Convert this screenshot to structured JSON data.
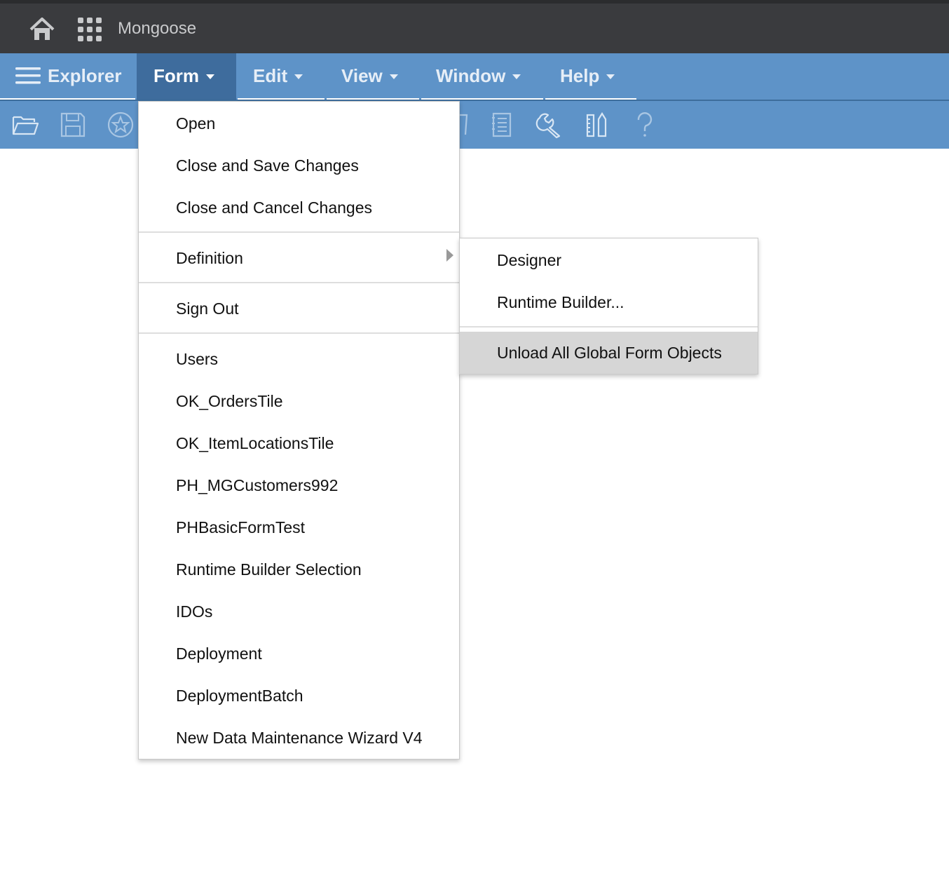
{
  "app": {
    "name": "Mongoose",
    "icons": {
      "home": "home-icon",
      "apps": "apps-grid-icon"
    }
  },
  "menubar": {
    "explorer": "Explorer",
    "form": "Form",
    "edit": "Edit",
    "view": "View",
    "window": "Window",
    "help": "Help"
  },
  "toolbar": {
    "icons": [
      "open-folder-icon",
      "save-icon",
      "favorite-star-icon",
      "clipboard-icon",
      "form-document-icon",
      "wrench-icon",
      "design-tools-icon",
      "help-icon"
    ]
  },
  "form_menu": {
    "open": "Open",
    "close_save": "Close and Save Changes",
    "close_cancel": "Close and Cancel Changes",
    "definition": "Definition",
    "sign_out": "Sign Out",
    "forms": [
      "Users",
      "OK_OrdersTile",
      "OK_ItemLocationsTile",
      "PH_MGCustomers992",
      "PHBasicFormTest",
      "Runtime Builder Selection",
      "IDOs",
      "Deployment",
      "DeploymentBatch",
      "New Data Maintenance Wizard V4"
    ]
  },
  "definition_submenu": {
    "designer": "Designer",
    "runtime_builder": "Runtime Builder...",
    "unload_all": "Unload All Global Form Objects"
  },
  "colors": {
    "header": "#3a3b3e",
    "menubar": "#5e93c8",
    "active_menu": "#3e6c9d",
    "highlight": "#d6d6d6"
  }
}
